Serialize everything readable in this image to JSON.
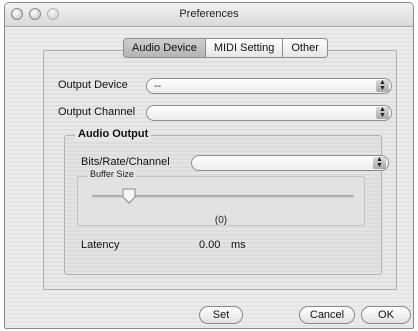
{
  "window": {
    "title": "Preferences"
  },
  "tabs": [
    {
      "label": "Audio Device",
      "selected": true
    },
    {
      "label": "MIDI Setting",
      "selected": false
    },
    {
      "label": "Other",
      "selected": false
    }
  ],
  "output_device": {
    "label": "Output Device",
    "value": "--"
  },
  "output_channel": {
    "label": "Output Channel",
    "value": ""
  },
  "audio_output": {
    "title": "Audio Output",
    "bits_rate_channel": {
      "label": "Bits/Rate/Channel",
      "value": ""
    },
    "buffer_size": {
      "title": "Buffer Size",
      "value_text": "(0)",
      "level": 0.14
    },
    "latency": {
      "label": "Latency",
      "value": "0.00",
      "unit": "ms"
    }
  },
  "buttons": {
    "set": "Set",
    "cancel": "Cancel",
    "ok": "OK"
  },
  "icons": {
    "close": "close-light-icon",
    "minimize": "minimize-light-icon",
    "zoom": "zoom-light-icon",
    "popup_arrows": "updown-arrows-icon"
  }
}
